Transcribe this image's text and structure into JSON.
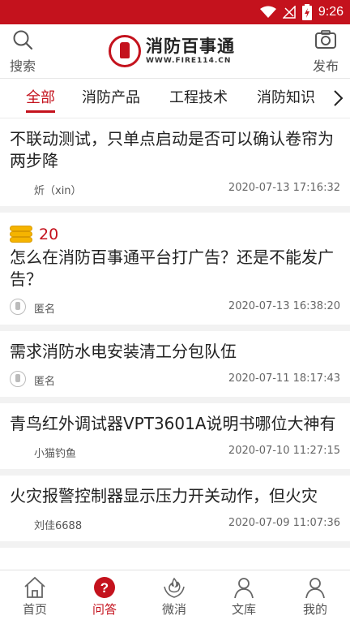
{
  "status_bar": {
    "time": "9:26",
    "color": "#c4121d"
  },
  "header": {
    "search_label": "搜索",
    "publish_label": "发布",
    "logo_cn": "消防百事通",
    "logo_en": "WWW.FIRE114.CN"
  },
  "tabs": [
    {
      "label": "全部",
      "active": true
    },
    {
      "label": "消防产品",
      "active": false
    },
    {
      "label": "工程技术",
      "active": false
    },
    {
      "label": "消防知识",
      "active": false
    }
  ],
  "questions": [
    {
      "title": "不联动测试，只单点启动是否可以确认卷帘为两步降",
      "author": "炘（xin）",
      "date": "2020-07-13 17:16:32"
    },
    {
      "reward": "20",
      "title": "怎么在消防百事通平台打广告？还是不能发广告？",
      "author": "匿名",
      "date": "2020-07-13 16:38:20"
    },
    {
      "title": "需求消防水电安装清工分包队伍",
      "author": "匿名",
      "date": "2020-07-11 18:17:43"
    },
    {
      "title": "青鸟红外调试器VPT3601A说明书哪位大神有",
      "author": "小猫钓鱼",
      "date": "2020-07-10 11:27:15"
    },
    {
      "title": "火灾报警控制器显示压力开关动作，但火灾",
      "author": "刘佳6688",
      "date": "2020-07-09 11:07:36"
    }
  ],
  "bottom_nav": [
    {
      "label": "首页",
      "icon": "home-icon",
      "active": false
    },
    {
      "label": "问答",
      "icon": "question-icon",
      "active": true
    },
    {
      "label": "微消",
      "icon": "fire-hands-icon",
      "active": false
    },
    {
      "label": "文库",
      "icon": "person-icon",
      "active": false
    },
    {
      "label": "我的",
      "icon": "user-icon",
      "active": false
    }
  ],
  "accent_color": "#c4121d"
}
